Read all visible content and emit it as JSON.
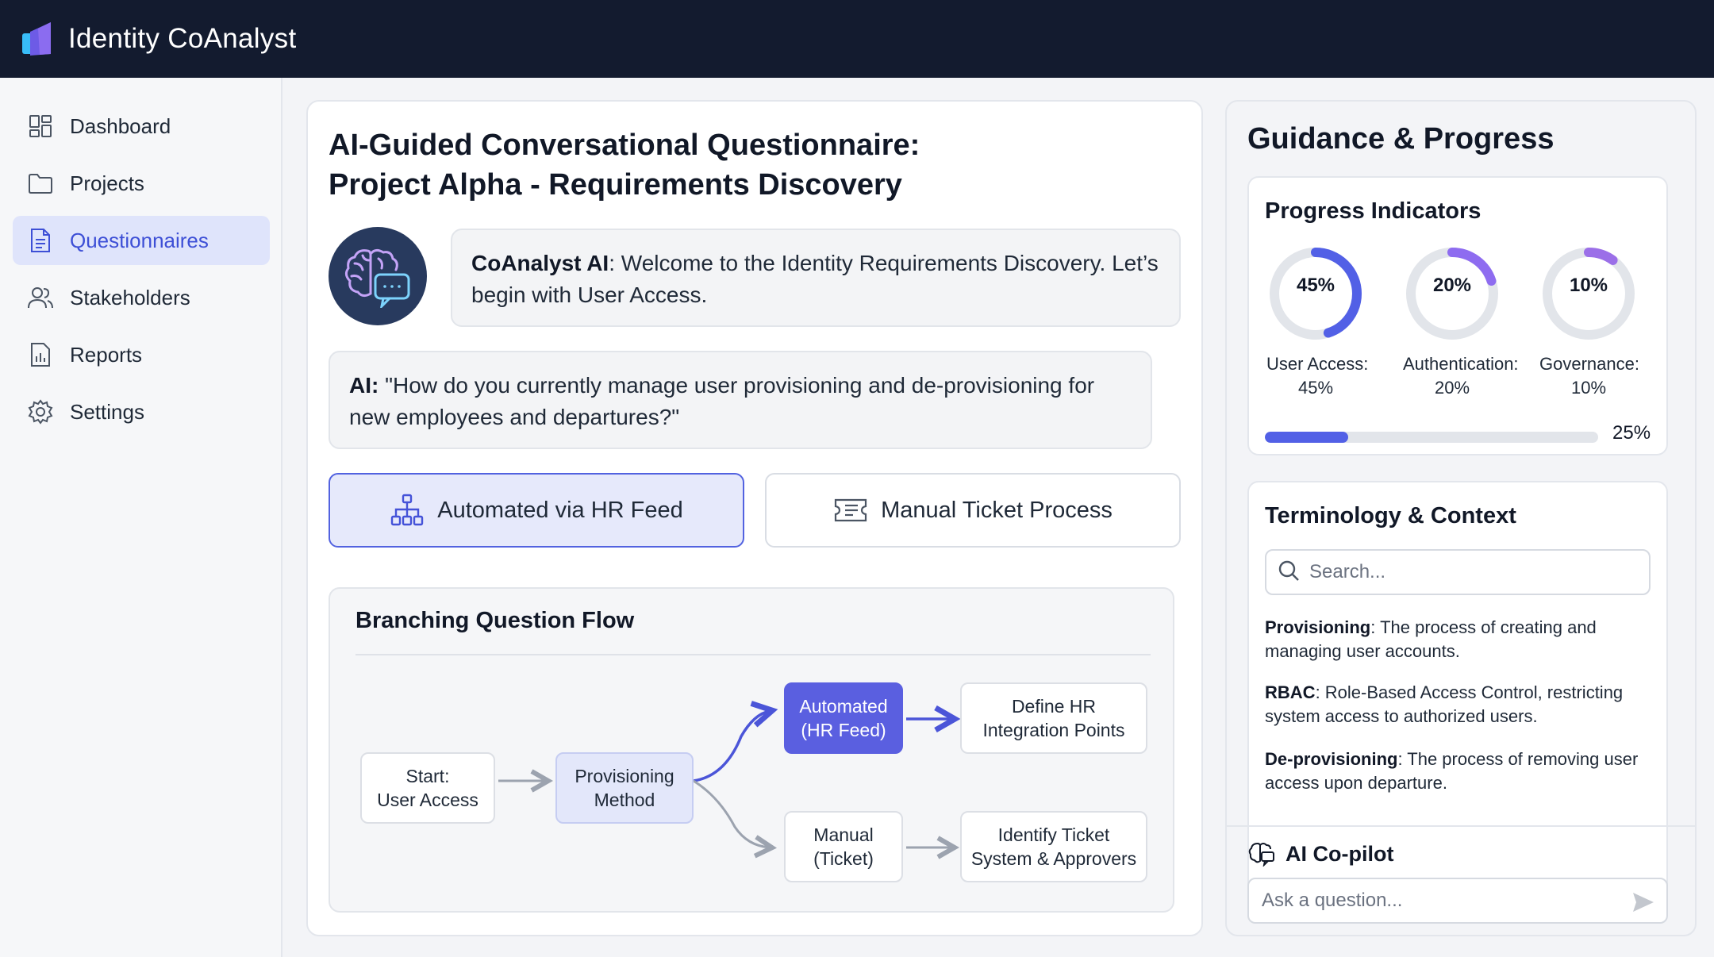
{
  "app": {
    "title": "Identity CoAnalyst"
  },
  "sidebar": {
    "items": [
      {
        "label": "Dashboard",
        "icon": "dashboard-icon"
      },
      {
        "label": "Projects",
        "icon": "folder-icon"
      },
      {
        "label": "Questionnaires",
        "icon": "document-icon",
        "active": true
      },
      {
        "label": "Stakeholders",
        "icon": "users-icon"
      },
      {
        "label": "Reports",
        "icon": "report-icon"
      },
      {
        "label": "Settings",
        "icon": "gear-icon"
      }
    ]
  },
  "main": {
    "title_line1": "AI-Guided Conversational Questionnaire:",
    "title_line2": "Project Alpha - Requirements Discovery",
    "welcome": {
      "speaker": "CoAnalyst AI",
      "text": ": Welcome to the Identity Requirements Discovery. Let’s begin with User Access."
    },
    "question": {
      "speaker": "AI:",
      "text": " \"How do you currently manage user provisioning and de-provisioning for new employees and departures?\""
    },
    "options": [
      {
        "label": "Automated via HR Feed",
        "icon": "hierarchy-icon",
        "selected": true
      },
      {
        "label": "Manual Ticket Process",
        "icon": "ticket-icon",
        "selected": false
      }
    ],
    "flow": {
      "title": "Branching Question Flow",
      "nodes": {
        "start_l1": "Start:",
        "start_l2": "User Access",
        "prov_l1": "Provisioning",
        "prov_l2": "Method",
        "auto_l1": "Automated",
        "auto_l2": "(HR Feed)",
        "define_l1": "Define HR",
        "define_l2": "Integration Points",
        "manual_l1": "Manual",
        "manual_l2": "(Ticket)",
        "identify_l1": "Identify Ticket",
        "identify_l2": "System & Approvers"
      }
    }
  },
  "guidance": {
    "title": "Guidance & Progress",
    "progress": {
      "title": "Progress Indicators",
      "indicators": [
        {
          "value_text": "45%",
          "label_l1": "User Access:",
          "label_l2": "45%",
          "value": 45
        },
        {
          "value_text": "20%",
          "label_l1": "Authentication:",
          "label_l2": "20%",
          "value": 20
        },
        {
          "value_text": "10%",
          "label_l1": "Governance:",
          "label_l2": "10%",
          "value": 10
        }
      ],
      "overall_text": "25%",
      "overall": 25
    },
    "terminology": {
      "title": "Terminology & Context",
      "search_placeholder": "Search...",
      "terms": [
        {
          "term": "Provisioning",
          "definition": ": The process of creating and managing user accounts."
        },
        {
          "term": "RBAC",
          "definition": ": Role-Based Access Control, restricting system access to authorized users."
        },
        {
          "term": "De-provisioning",
          "definition": ": The process of removing user access upon departure."
        }
      ]
    },
    "copilot": {
      "title": "AI Co-pilot",
      "placeholder": "Ask a question..."
    }
  },
  "colors": {
    "accent": "#5260e6",
    "topbar": "#131b2f",
    "avatar": "#283a5e",
    "donut_track": "#e2e5ea",
    "donut_user_access": "#5260e6",
    "donut_authentication": "#8e6cf0",
    "donut_governance": "#9b6fe8"
  }
}
